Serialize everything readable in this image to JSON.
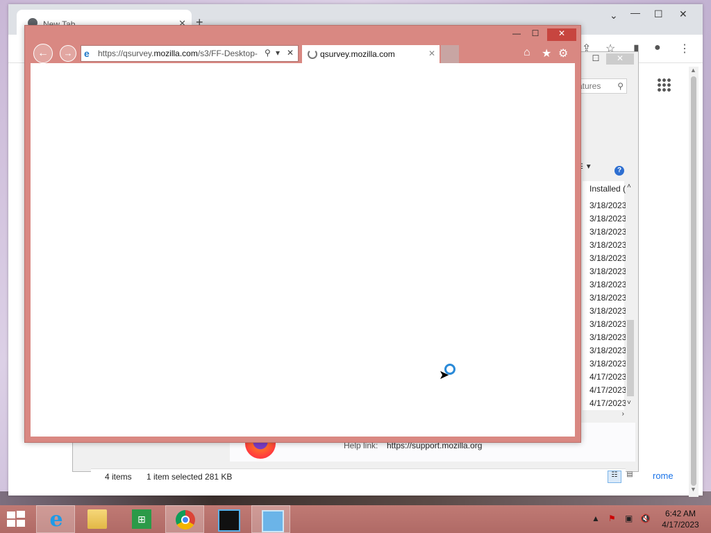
{
  "chrome": {
    "tab_title": "New Tab",
    "tab_close": "✕",
    "new_tab": "+",
    "minimize": "—",
    "maximize": "☐",
    "close": "✕",
    "tab_search": "⌄",
    "bottom_link": "rome"
  },
  "programs_features": {
    "search_placeholder": "atures",
    "column_header": "Installed (",
    "install_dates": [
      "3/18/2023",
      "3/18/2023",
      "3/18/2023",
      "3/18/2023",
      "3/18/2023",
      "3/18/2023",
      "3/18/2023",
      "3/18/2023",
      "3/18/2023",
      "3/18/2023",
      "3/18/2023",
      "3/18/2023",
      "3/18/2023",
      "4/17/2023",
      "4/17/2023",
      "4/17/2023"
    ],
    "help_link_label": "Help link:",
    "help_link_value": "https://support.mozilla.org",
    "status_items": "4 items",
    "status_selected": "1 item selected  281 KB"
  },
  "ie": {
    "address_prefix": "https://qsurvey.",
    "address_domain": "mozilla.com",
    "address_suffix": "/s3/FF-Desktop-",
    "tab_title": "qsurvey.mozilla.com",
    "tab_close": "✕",
    "minimize": "—",
    "maximize": "☐",
    "close": "✕"
  },
  "taskbar": {
    "time": "6:42 AM",
    "date": "4/17/2023"
  },
  "icons": [
    "windows-start-icon",
    "internet-explorer-icon",
    "file-explorer-icon",
    "store-icon",
    "chrome-icon",
    "media-icon",
    "control-panel-icon",
    "home-icon",
    "favorites-star-icon",
    "settings-gear-icon",
    "back-arrow-icon",
    "forward-arrow-icon",
    "search-icon",
    "refresh-stop-icon",
    "loading-spinner-icon",
    "help-icon",
    "apps-grid-icon"
  ],
  "colors": {
    "ie_frame": "#d98882",
    "taskbar": "#b8716c",
    "accent_blue": "#1e78c8"
  }
}
